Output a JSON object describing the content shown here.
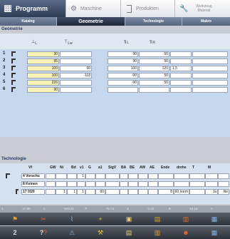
{
  "top_tabs": [
    {
      "label": "Programm",
      "icon": "grid-icon",
      "active": true
    },
    {
      "label": "Maschine",
      "icon": "gears-icon",
      "active": false
    },
    {
      "label": "Produkten",
      "icon": "tab-icon",
      "active": false
    },
    {
      "label": "Werkzeug Material",
      "icon": "wrench-icon",
      "active": false
    }
  ],
  "sub_tabs": [
    {
      "label": "Katalog",
      "active": false
    },
    {
      "label": "Geometrie",
      "active": true
    },
    {
      "label": "Technologie",
      "active": false
    },
    {
      "label": "Makro",
      "active": false
    }
  ],
  "geometry": {
    "title": "Geometrie",
    "col_headers": [
      "L",
      "Lw",
      "L",
      "R"
    ],
    "rows": [
      {
        "num": "1",
        "c1": "30",
        "c2": "",
        "c3": "90",
        "c4": "50",
        "extra": ""
      },
      {
        "num": "2",
        "c1": "95",
        "c2": "",
        "c3": "90",
        "c4": "50",
        "extra": ""
      },
      {
        "num": "3",
        "c1": "100",
        "c2": "60",
        "c3": "100",
        "c4": "120",
        "extra": "1,5"
      },
      {
        "num": "4",
        "c1": "100",
        "c2": "-118",
        "c3": "-90",
        "c4": "50",
        "extra": ""
      },
      {
        "num": "5",
        "c1": "226",
        "c2": "",
        "c3": "-90",
        "c4": "50",
        "extra": ""
      },
      {
        "num": "6",
        "c1": "90",
        "c2": "",
        "c3": "",
        "c4": "",
        "extra": ""
      }
    ]
  },
  "technology": {
    "title": "Technologie",
    "headers": [
      "Vf",
      "GW",
      "Ni",
      "Bd",
      "v1",
      "G",
      "a1",
      "SigV",
      "BA",
      "BE",
      "AW",
      "AE",
      "Ende",
      "drehe",
      "T",
      "M"
    ],
    "rows": [
      {
        "label": "4 Vorschu",
        "vals": [
          "",
          "",
          "",
          "1",
          "",
          "",
          "",
          "",
          "",
          "",
          "",
          "",
          "",
          "",
          "",
          ""
        ]
      },
      {
        "label": "8 Keinen",
        "vals": [
          "",
          "",
          "",
          "",
          "",
          "",
          "",
          "",
          "",
          "",
          "",
          "",
          "",
          "",
          "",
          ""
        ]
      },
      {
        "label": "17 0/20",
        "vals": [
          "",
          "1",
          "1",
          "1",
          "",
          "60",
          "",
          "",
          "",
          "",
          "",
          "8",
          "60 norm",
          "",
          "Ja",
          "Ne"
        ]
      }
    ]
  },
  "status": {
    "items": [
      "1",
      "47.86",
      "C",
      "659.01",
      "P",
      "70.73",
      "Z",
      "0.50",
      "B",
      "54.15",
      "A"
    ]
  },
  "bottom": {
    "row1": [
      "",
      "",
      "",
      "",
      "",
      "",
      "",
      ""
    ],
    "row2": [
      "2",
      "?",
      "",
      "",
      "",
      "",
      "",
      ""
    ]
  }
}
